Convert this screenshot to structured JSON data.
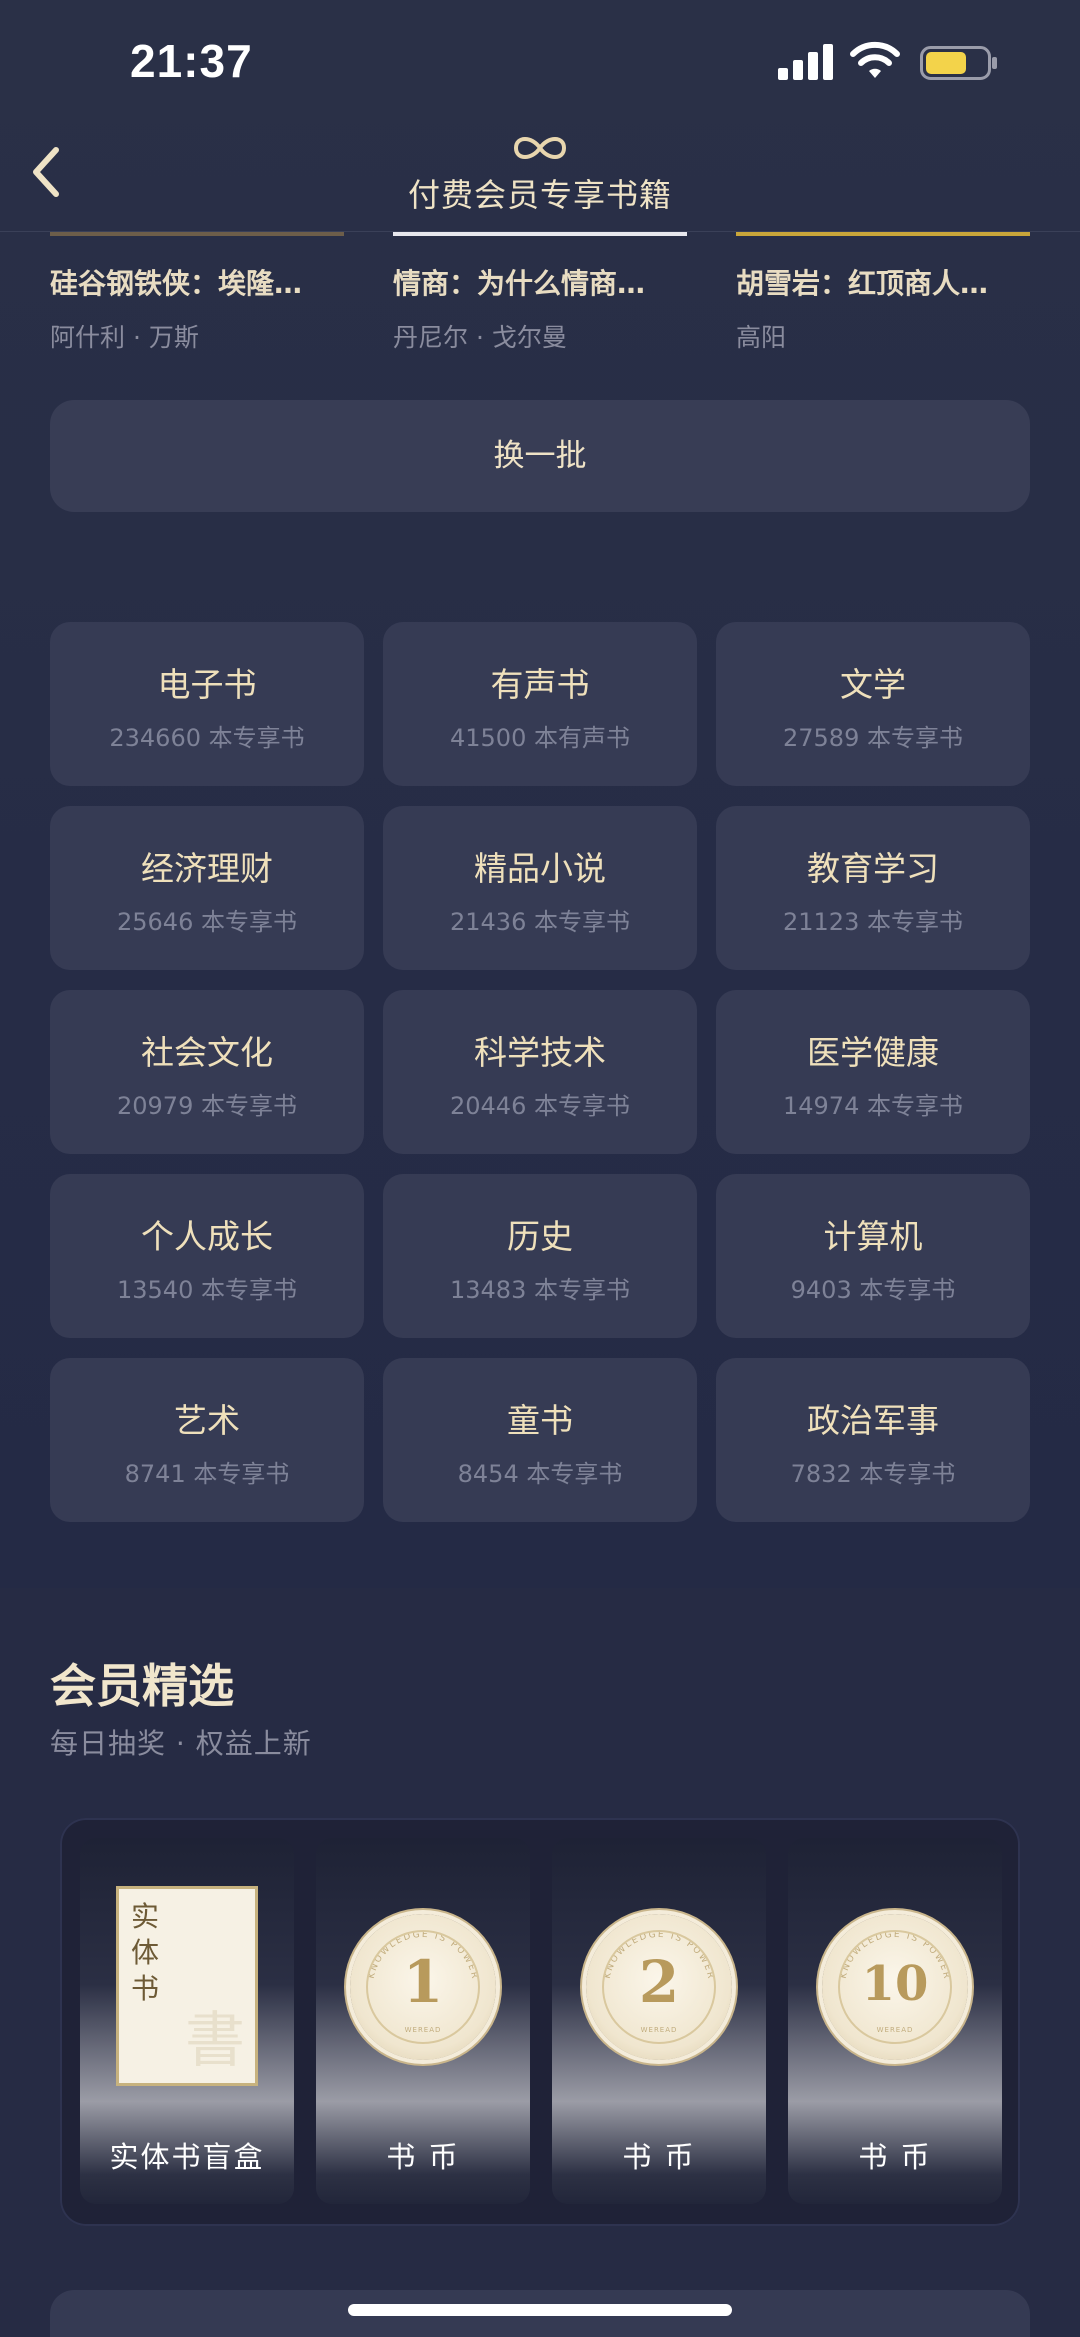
{
  "status_bar": {
    "time": "21:37"
  },
  "nav": {
    "title": "付费会员专享书籍"
  },
  "books": [
    {
      "title": "硅谷钢铁侠：埃隆…",
      "author": "阿什利 · 万斯",
      "accent": "#7a6a55"
    },
    {
      "title": "情商：为什么情商…",
      "author": "丹尼尔 · 戈尔曼",
      "accent": "#e8e8ee"
    },
    {
      "title": "胡雪岩：红顶商人…",
      "author": "高阳",
      "accent": "#c9a63a"
    }
  ],
  "refresh": {
    "label": "换一批"
  },
  "categories": [
    {
      "name": "电子书",
      "count": "234660 本专享书"
    },
    {
      "name": "有声书",
      "count": "41500 本有声书"
    },
    {
      "name": "文学",
      "count": "27589 本专享书"
    },
    {
      "name": "经济理财",
      "count": "25646 本专享书"
    },
    {
      "name": "精品小说",
      "count": "21436 本专享书"
    },
    {
      "name": "教育学习",
      "count": "21123 本专享书"
    },
    {
      "name": "社会文化",
      "count": "20979 本专享书"
    },
    {
      "name": "科学技术",
      "count": "20446 本专享书"
    },
    {
      "name": "医学健康",
      "count": "14974 本专享书"
    },
    {
      "name": "个人成长",
      "count": "13540 本专享书"
    },
    {
      "name": "历史",
      "count": "13483 本专享书"
    },
    {
      "name": "计算机",
      "count": "9403 本专享书"
    },
    {
      "name": "艺术",
      "count": "8741 本专享书"
    },
    {
      "name": "童书",
      "count": "8454 本专享书"
    },
    {
      "name": "政治军事",
      "count": "7832 本专享书"
    }
  ],
  "member_section": {
    "title": "会员精选",
    "subtitle": "每日抽奖 · 权益上新",
    "rewards": [
      {
        "label": "实体书盲盒",
        "box_text": "实体书",
        "box_mark": "書"
      },
      {
        "label": "书 币",
        "coin": "1",
        "coin_ring": "KNOWLEDGE IS POWER",
        "coin_brand": "WEREAD"
      },
      {
        "label": "书 币",
        "coin": "2",
        "coin_ring": "KNOWLEDGE IS POWER",
        "coin_brand": "WEREAD"
      },
      {
        "label": "书 币",
        "coin": "10",
        "coin_ring": "KNOWLEDGE IS POWER",
        "coin_brand": "WEREAD"
      }
    ]
  },
  "bottom_card": {
    "label": ""
  },
  "colors": {
    "background": "#262b44",
    "card": "#363b54",
    "gold_text": "#efe0bb",
    "muted": "#7e8297"
  }
}
